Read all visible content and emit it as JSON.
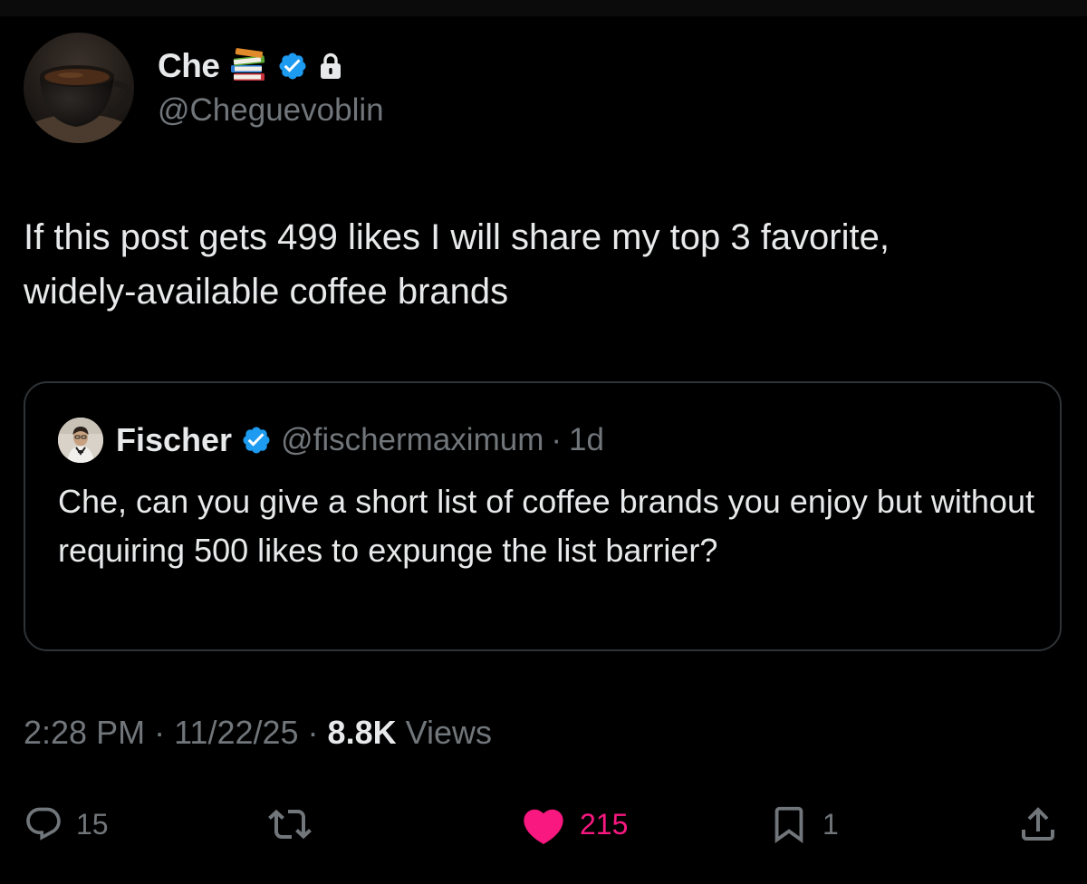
{
  "colors": {
    "background": "#000000",
    "text_primary": "#e7e9ea",
    "text_secondary": "#71767b",
    "verified_blue": "#1d9bf0",
    "like_pink": "#f91880",
    "border": "#2f3336"
  },
  "post": {
    "author": {
      "name": "Che",
      "handle": "@Cheguevoblin",
      "avatar_icon": "coffee-cup-avatar",
      "emoji_icon": "books-icon",
      "verified_icon": "verified-badge-icon",
      "lock_icon": "lock-icon"
    },
    "text": "If this post gets 499 likes I will share my top 3 favorite,\nwidely-available coffee brands",
    "quoted": {
      "name": "Fischer",
      "handle": "@fischermaximum",
      "separator": "·",
      "time": "1d",
      "avatar_icon": "person-avatar",
      "verified_icon": "verified-badge-icon",
      "text": "Che, can you give a short list of coffee brands you enjoy but without requiring 500 likes to expunge the list barrier?"
    },
    "meta": {
      "time": "2:28 PM",
      "sep1": "·",
      "date": "11/22/25",
      "sep2": "·",
      "views_count": "8.8K",
      "views_label": "Views"
    },
    "actions": {
      "replies": {
        "icon": "reply-icon",
        "count": "15"
      },
      "reposts": {
        "icon": "repost-icon",
        "count": ""
      },
      "likes": {
        "icon": "heart-filled-icon",
        "count": "215",
        "liked": true
      },
      "bookmarks": {
        "icon": "bookmark-icon",
        "count": "1"
      },
      "share": {
        "icon": "share-icon"
      }
    }
  }
}
